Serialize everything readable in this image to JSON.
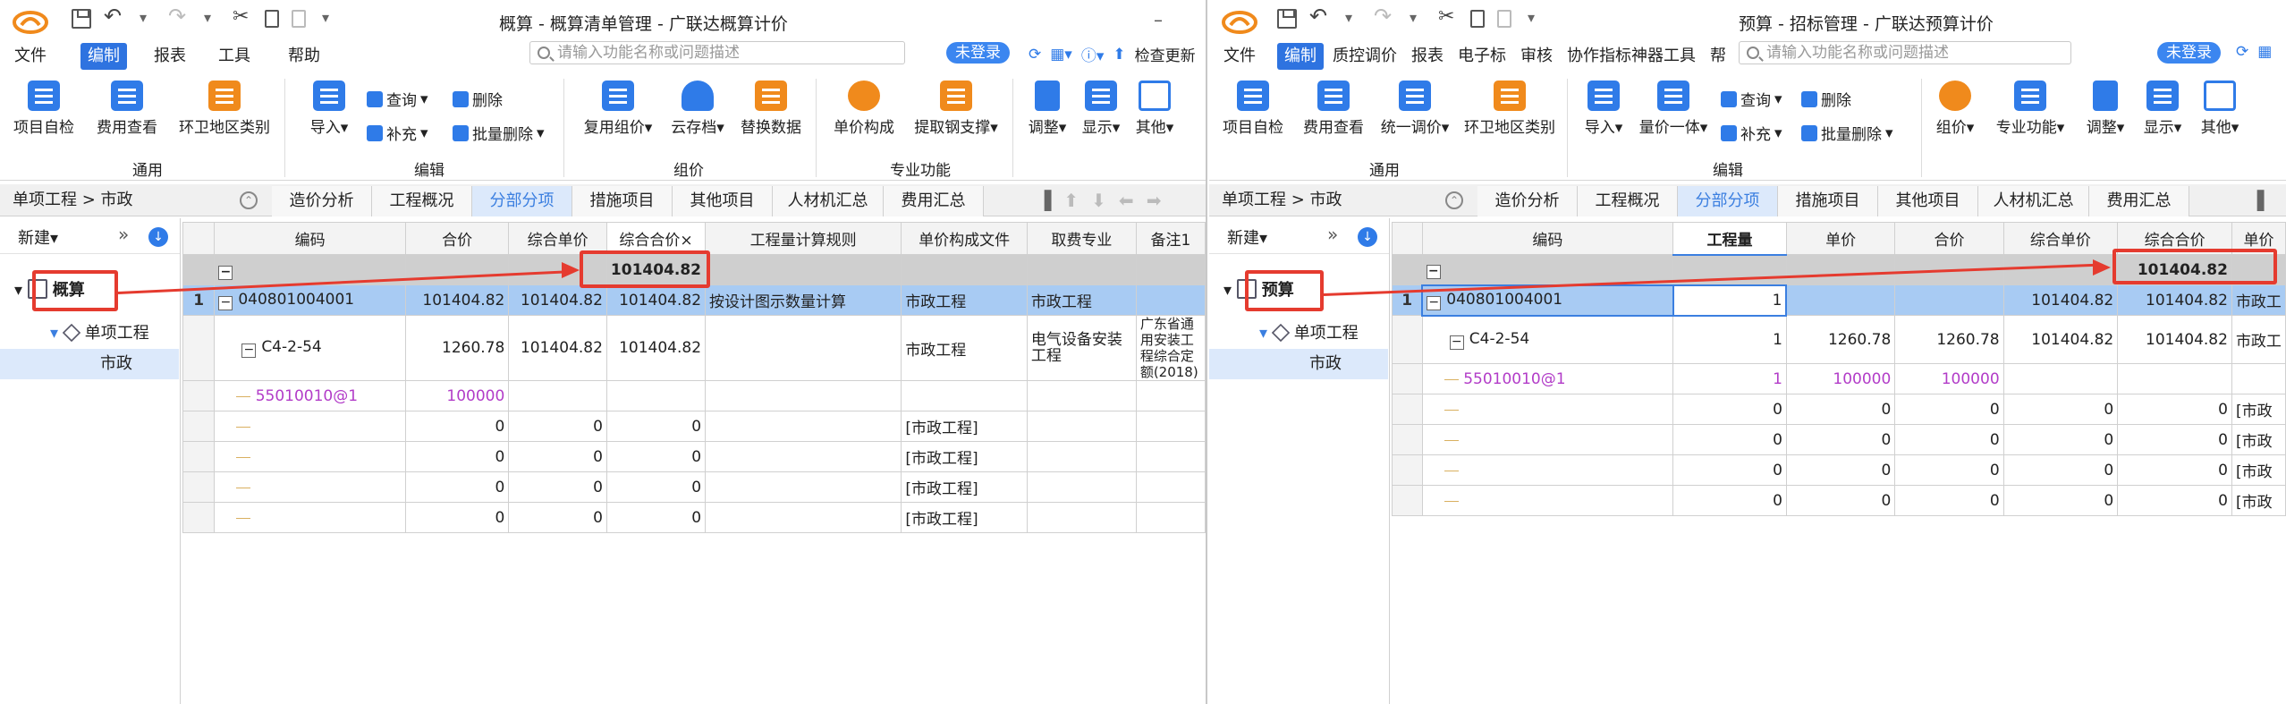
{
  "left": {
    "window_title": "概算 - 概算清单管理 - 广联达概算计价",
    "menu": [
      "文件",
      "编制",
      "报表",
      "工具",
      "帮助"
    ],
    "search_placeholder": "请输入功能名称或问题描述",
    "login_label": "未登录",
    "check_label": "检查更新",
    "ribbon": {
      "general": [
        "项目自检",
        "费用查看",
        "环卫地区类别"
      ],
      "import": "导入",
      "query": "查询",
      "supplement": "补充",
      "delete": "删除",
      "batch_delete": "批量删除",
      "reuse": "复用组价",
      "cloud": "云存档",
      "replace": "替换数据",
      "unit_composition": "单价构成",
      "extract_steel": "提取钢支撑",
      "adjust": "调整",
      "display": "显示",
      "other": "其他",
      "groups": [
        "通用",
        "编辑",
        "组价",
        "专业功能"
      ]
    },
    "breadcrumb": "单项工程 > 市政",
    "tabs": [
      "造价分析",
      "工程概况",
      "分部分项",
      "措施项目",
      "其他项目",
      "人材机汇总",
      "费用汇总"
    ],
    "tree": {
      "new": "新建",
      "root": "概算",
      "child": "单项工程",
      "leaf": "市政"
    },
    "columns": [
      "编码",
      "合价",
      "综合单价",
      "综合合价",
      "工程量计算规则",
      "单价构成文件",
      "取费专业",
      "备注1"
    ],
    "group_total": "101404.82",
    "rows": [
      {
        "num": "1",
        "code": "040801004001",
        "total": "101404.82",
        "unit": "101404.82",
        "comp_total": "101404.82",
        "rule": "按设计图示数量计算",
        "file": "市政工程",
        "fee": "市政工程",
        "note": ""
      },
      {
        "num": "",
        "code": "C4-2-54",
        "total": "1260.78",
        "unit": "101404.82",
        "comp_total": "101404.82",
        "rule": "",
        "file": "市政工程",
        "fee": "电气设备安装工程",
        "note": "广东省通用安装工程综合定额(2018)"
      },
      {
        "num": "",
        "code": "55010010@1",
        "total": "100000",
        "unit": "",
        "comp_total": "",
        "rule": "",
        "file": "",
        "fee": "",
        "note": ""
      },
      {
        "num": "",
        "code": "",
        "total": "0",
        "unit": "0",
        "comp_total": "0",
        "rule": "",
        "file": "[市政工程]",
        "fee": "",
        "note": ""
      },
      {
        "num": "",
        "code": "",
        "total": "0",
        "unit": "0",
        "comp_total": "0",
        "rule": "",
        "file": "[市政工程]",
        "fee": "",
        "note": ""
      },
      {
        "num": "",
        "code": "",
        "total": "0",
        "unit": "0",
        "comp_total": "0",
        "rule": "",
        "file": "[市政工程]",
        "fee": "",
        "note": ""
      },
      {
        "num": "",
        "code": "",
        "total": "0",
        "unit": "0",
        "comp_total": "0",
        "rule": "",
        "file": "[市政工程]",
        "fee": "",
        "note": ""
      }
    ]
  },
  "right": {
    "window_title": "预算 - 招标管理 - 广联达预算计价",
    "menu": [
      "文件",
      "编制",
      "质控调价",
      "报表",
      "电子标",
      "审核",
      "协作指标神器工具",
      "帮助"
    ],
    "search_placeholder": "请输入功能名称或问题描述",
    "login_label": "未登录",
    "ribbon": {
      "general": [
        "项目自检",
        "费用查看",
        "统一调价",
        "环卫地区类别"
      ],
      "import": "导入",
      "quantity": "量价一体",
      "query": "查询",
      "supplement": "补充",
      "delete": "删除",
      "batch_delete": "批量删除",
      "pricing": "组价",
      "professional": "专业功能",
      "adjust": "调整",
      "display": "显示",
      "other": "其他",
      "groups": [
        "通用",
        "编辑"
      ]
    },
    "breadcrumb": "单项工程 > 市政",
    "tabs": [
      "造价分析",
      "工程概况",
      "分部分项",
      "措施项目",
      "其他项目",
      "人材机汇总",
      "费用汇总"
    ],
    "tree": {
      "new": "新建",
      "root": "预算",
      "child": "单项工程",
      "leaf": "市政"
    },
    "columns": [
      "编码",
      "工程量",
      "单价",
      "合价",
      "综合单价",
      "综合合价",
      "单价"
    ],
    "group_total": "101404.82",
    "rows": [
      {
        "num": "1",
        "code": "040801004001",
        "qty": "1",
        "price": "",
        "total": "",
        "unit": "101404.82",
        "comp_total": "101404.82",
        "file": "市政工"
      },
      {
        "num": "",
        "code": "C4-2-54",
        "qty": "1",
        "price": "1260.78",
        "total": "1260.78",
        "unit": "101404.82",
        "comp_total": "101404.82",
        "file": "市政工"
      },
      {
        "num": "",
        "code": "55010010@1",
        "qty": "1",
        "price": "100000",
        "total": "100000",
        "unit": "",
        "comp_total": "",
        "file": ""
      },
      {
        "num": "",
        "code": "",
        "qty": "0",
        "price": "0",
        "total": "0",
        "unit": "0",
        "comp_total": "0",
        "file": "[市政"
      },
      {
        "num": "",
        "code": "",
        "qty": "0",
        "price": "0",
        "total": "0",
        "unit": "0",
        "comp_total": "0",
        "file": "[市政"
      },
      {
        "num": "",
        "code": "",
        "qty": "0",
        "price": "0",
        "total": "0",
        "unit": "0",
        "comp_total": "0",
        "file": "[市政"
      },
      {
        "num": "",
        "code": "",
        "qty": "0",
        "price": "0",
        "total": "0",
        "unit": "0",
        "comp_total": "0",
        "file": "[市政"
      }
    ]
  },
  "colors": {
    "accent": "#2e73e0",
    "highlight": "#e53b2f",
    "selected_row": "#a8cbf3",
    "pink_text": "#b23cc8"
  }
}
